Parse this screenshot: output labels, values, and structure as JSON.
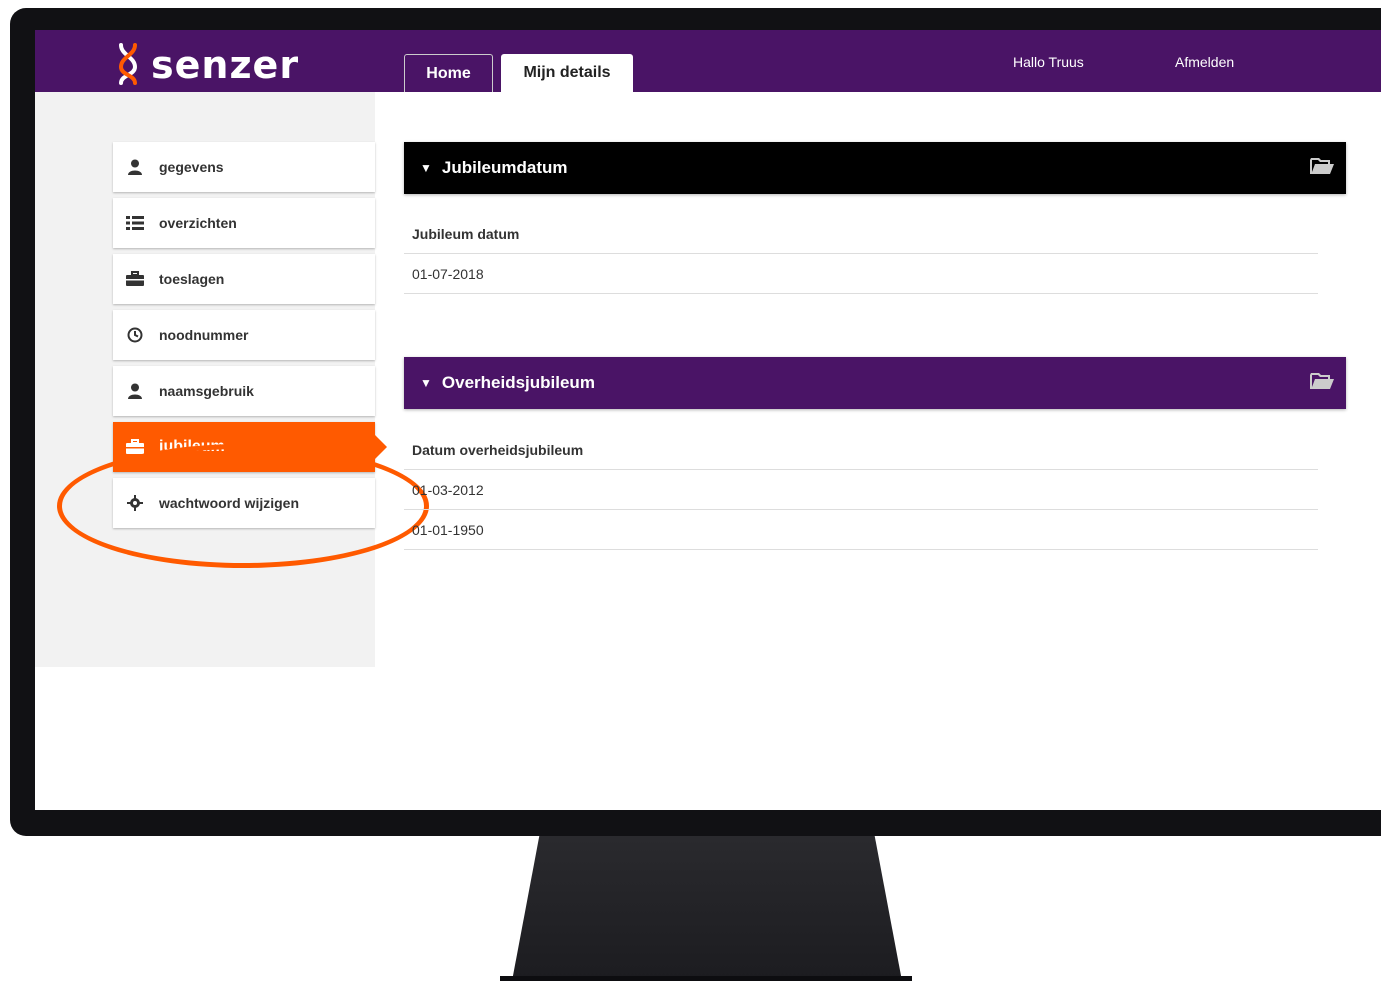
{
  "brand": {
    "name": "senzer",
    "color_primary": "#4a1466",
    "color_accent": "#ff5a00"
  },
  "header": {
    "tabs": [
      {
        "label": "Home"
      },
      {
        "label": "Mijn details"
      }
    ],
    "greeting": "Hallo Truus",
    "logout": "Afmelden"
  },
  "sidebar": {
    "items": [
      {
        "label": "gegevens",
        "icon": "user-icon"
      },
      {
        "label": "overzichten",
        "icon": "list-icon"
      },
      {
        "label": "toeslagen",
        "icon": "briefcase-icon"
      },
      {
        "label": "noodnummer",
        "icon": "clock-icon"
      },
      {
        "label": "naamsgebruik",
        "icon": "user-icon"
      },
      {
        "label": "jubileum",
        "icon": "briefcase-icon",
        "active": true
      },
      {
        "label": "wachtwoord wijzigen",
        "icon": "gear-icon"
      }
    ]
  },
  "sections": [
    {
      "title": "Jubileumdatum",
      "column_header": "Jubileum datum",
      "rows": [
        "01-07-2018"
      ]
    },
    {
      "title": "Overheidsjubileum",
      "column_header": "Datum overheidsjubileum",
      "rows": [
        "01-03-2012",
        "01-01-1950"
      ]
    }
  ]
}
